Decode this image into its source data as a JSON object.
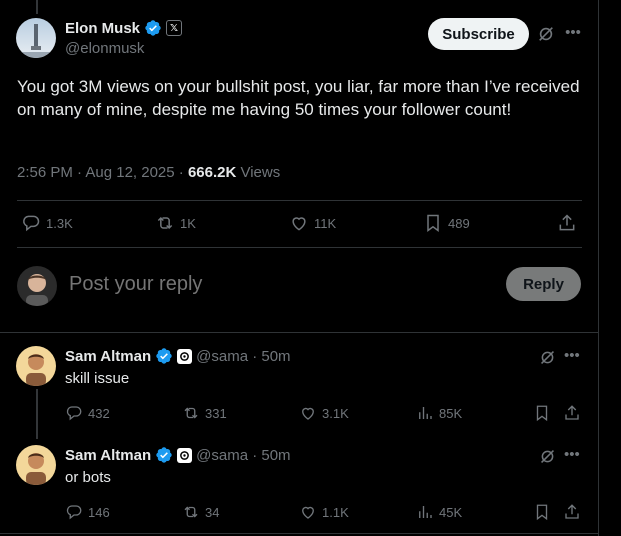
{
  "post": {
    "author_name": "Elon Musk",
    "author_handle": "@elonmusk",
    "subscribe_label": "Subscribe",
    "text": "You got 3M views on your bullshit post, you liar, far more than I’ve received on many of mine, despite me having 50 times your follower count!",
    "time": "2:56 PM · Aug 12, 2025 · ",
    "views_count": "666.2K",
    "views_label": " Views",
    "stats": {
      "replies": "1.3K",
      "reposts": "1K",
      "likes": "11K",
      "bookmarks": "489"
    }
  },
  "reply_box": {
    "placeholder": "Post your reply",
    "button_label": "Reply"
  },
  "comments": [
    {
      "name": "Sam Altman",
      "handle": "@sama · 50m",
      "text": "skill issue",
      "replies": "432",
      "reposts": "331",
      "likes": "3.1K",
      "views": "85K"
    },
    {
      "name": "Sam Altman",
      "handle": "@sama · 50m",
      "text": "or bots",
      "replies": "146",
      "reposts": "34",
      "likes": "1.1K",
      "views": "45K"
    }
  ],
  "icons": {
    "verified": "verified-badge-icon",
    "grok": "grok-icon",
    "more": "more-icon",
    "reply": "reply-icon",
    "repost": "repost-icon",
    "like": "heart-icon",
    "bookmark": "bookmark-icon",
    "share": "share-icon",
    "views": "views-icon"
  },
  "colors": {
    "background": "#000000",
    "text": "#e7e9ea",
    "muted": "#71767b",
    "verified": "#1d9bf0",
    "divider": "#2f3336"
  }
}
